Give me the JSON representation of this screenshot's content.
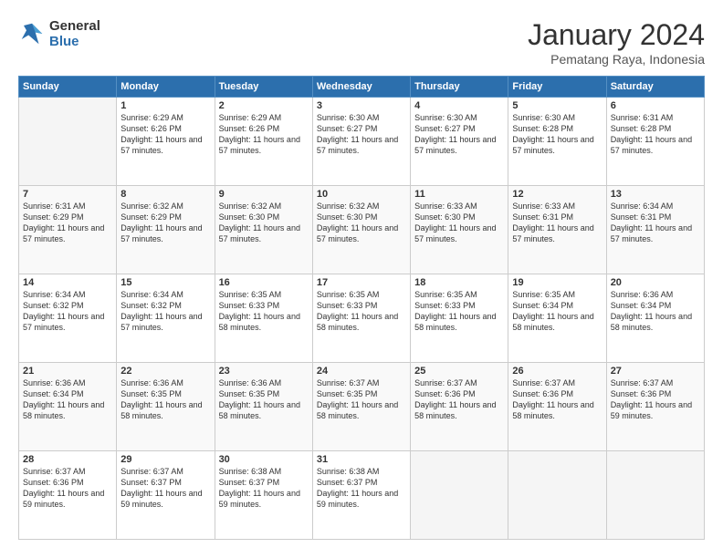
{
  "logo": {
    "line1": "General",
    "line2": "Blue"
  },
  "title": "January 2024",
  "subtitle": "Pematang Raya, Indonesia",
  "headers": [
    "Sunday",
    "Monday",
    "Tuesday",
    "Wednesday",
    "Thursday",
    "Friday",
    "Saturday"
  ],
  "weeks": [
    [
      {
        "day": "",
        "empty": true
      },
      {
        "day": "1",
        "sunrise": "6:29 AM",
        "sunset": "6:26 PM",
        "daylight": "11 hours and 57 minutes."
      },
      {
        "day": "2",
        "sunrise": "6:29 AM",
        "sunset": "6:26 PM",
        "daylight": "11 hours and 57 minutes."
      },
      {
        "day": "3",
        "sunrise": "6:30 AM",
        "sunset": "6:27 PM",
        "daylight": "11 hours and 57 minutes."
      },
      {
        "day": "4",
        "sunrise": "6:30 AM",
        "sunset": "6:27 PM",
        "daylight": "11 hours and 57 minutes."
      },
      {
        "day": "5",
        "sunrise": "6:30 AM",
        "sunset": "6:28 PM",
        "daylight": "11 hours and 57 minutes."
      },
      {
        "day": "6",
        "sunrise": "6:31 AM",
        "sunset": "6:28 PM",
        "daylight": "11 hours and 57 minutes."
      }
    ],
    [
      {
        "day": "7",
        "sunrise": "6:31 AM",
        "sunset": "6:29 PM",
        "daylight": "11 hours and 57 minutes."
      },
      {
        "day": "8",
        "sunrise": "6:32 AM",
        "sunset": "6:29 PM",
        "daylight": "11 hours and 57 minutes."
      },
      {
        "day": "9",
        "sunrise": "6:32 AM",
        "sunset": "6:30 PM",
        "daylight": "11 hours and 57 minutes."
      },
      {
        "day": "10",
        "sunrise": "6:32 AM",
        "sunset": "6:30 PM",
        "daylight": "11 hours and 57 minutes."
      },
      {
        "day": "11",
        "sunrise": "6:33 AM",
        "sunset": "6:30 PM",
        "daylight": "11 hours and 57 minutes."
      },
      {
        "day": "12",
        "sunrise": "6:33 AM",
        "sunset": "6:31 PM",
        "daylight": "11 hours and 57 minutes."
      },
      {
        "day": "13",
        "sunrise": "6:34 AM",
        "sunset": "6:31 PM",
        "daylight": "11 hours and 57 minutes."
      }
    ],
    [
      {
        "day": "14",
        "sunrise": "6:34 AM",
        "sunset": "6:32 PM",
        "daylight": "11 hours and 57 minutes."
      },
      {
        "day": "15",
        "sunrise": "6:34 AM",
        "sunset": "6:32 PM",
        "daylight": "11 hours and 57 minutes."
      },
      {
        "day": "16",
        "sunrise": "6:35 AM",
        "sunset": "6:33 PM",
        "daylight": "11 hours and 58 minutes."
      },
      {
        "day": "17",
        "sunrise": "6:35 AM",
        "sunset": "6:33 PM",
        "daylight": "11 hours and 58 minutes."
      },
      {
        "day": "18",
        "sunrise": "6:35 AM",
        "sunset": "6:33 PM",
        "daylight": "11 hours and 58 minutes."
      },
      {
        "day": "19",
        "sunrise": "6:35 AM",
        "sunset": "6:34 PM",
        "daylight": "11 hours and 58 minutes."
      },
      {
        "day": "20",
        "sunrise": "6:36 AM",
        "sunset": "6:34 PM",
        "daylight": "11 hours and 58 minutes."
      }
    ],
    [
      {
        "day": "21",
        "sunrise": "6:36 AM",
        "sunset": "6:34 PM",
        "daylight": "11 hours and 58 minutes."
      },
      {
        "day": "22",
        "sunrise": "6:36 AM",
        "sunset": "6:35 PM",
        "daylight": "11 hours and 58 minutes."
      },
      {
        "day": "23",
        "sunrise": "6:36 AM",
        "sunset": "6:35 PM",
        "daylight": "11 hours and 58 minutes."
      },
      {
        "day": "24",
        "sunrise": "6:37 AM",
        "sunset": "6:35 PM",
        "daylight": "11 hours and 58 minutes."
      },
      {
        "day": "25",
        "sunrise": "6:37 AM",
        "sunset": "6:36 PM",
        "daylight": "11 hours and 58 minutes."
      },
      {
        "day": "26",
        "sunrise": "6:37 AM",
        "sunset": "6:36 PM",
        "daylight": "11 hours and 58 minutes."
      },
      {
        "day": "27",
        "sunrise": "6:37 AM",
        "sunset": "6:36 PM",
        "daylight": "11 hours and 59 minutes."
      }
    ],
    [
      {
        "day": "28",
        "sunrise": "6:37 AM",
        "sunset": "6:36 PM",
        "daylight": "11 hours and 59 minutes."
      },
      {
        "day": "29",
        "sunrise": "6:37 AM",
        "sunset": "6:37 PM",
        "daylight": "11 hours and 59 minutes."
      },
      {
        "day": "30",
        "sunrise": "6:38 AM",
        "sunset": "6:37 PM",
        "daylight": "11 hours and 59 minutes."
      },
      {
        "day": "31",
        "sunrise": "6:38 AM",
        "sunset": "6:37 PM",
        "daylight": "11 hours and 59 minutes."
      },
      {
        "day": "",
        "empty": true
      },
      {
        "day": "",
        "empty": true
      },
      {
        "day": "",
        "empty": true
      }
    ]
  ],
  "labels": {
    "sunrise": "Sunrise:",
    "sunset": "Sunset:",
    "daylight": "Daylight:"
  }
}
